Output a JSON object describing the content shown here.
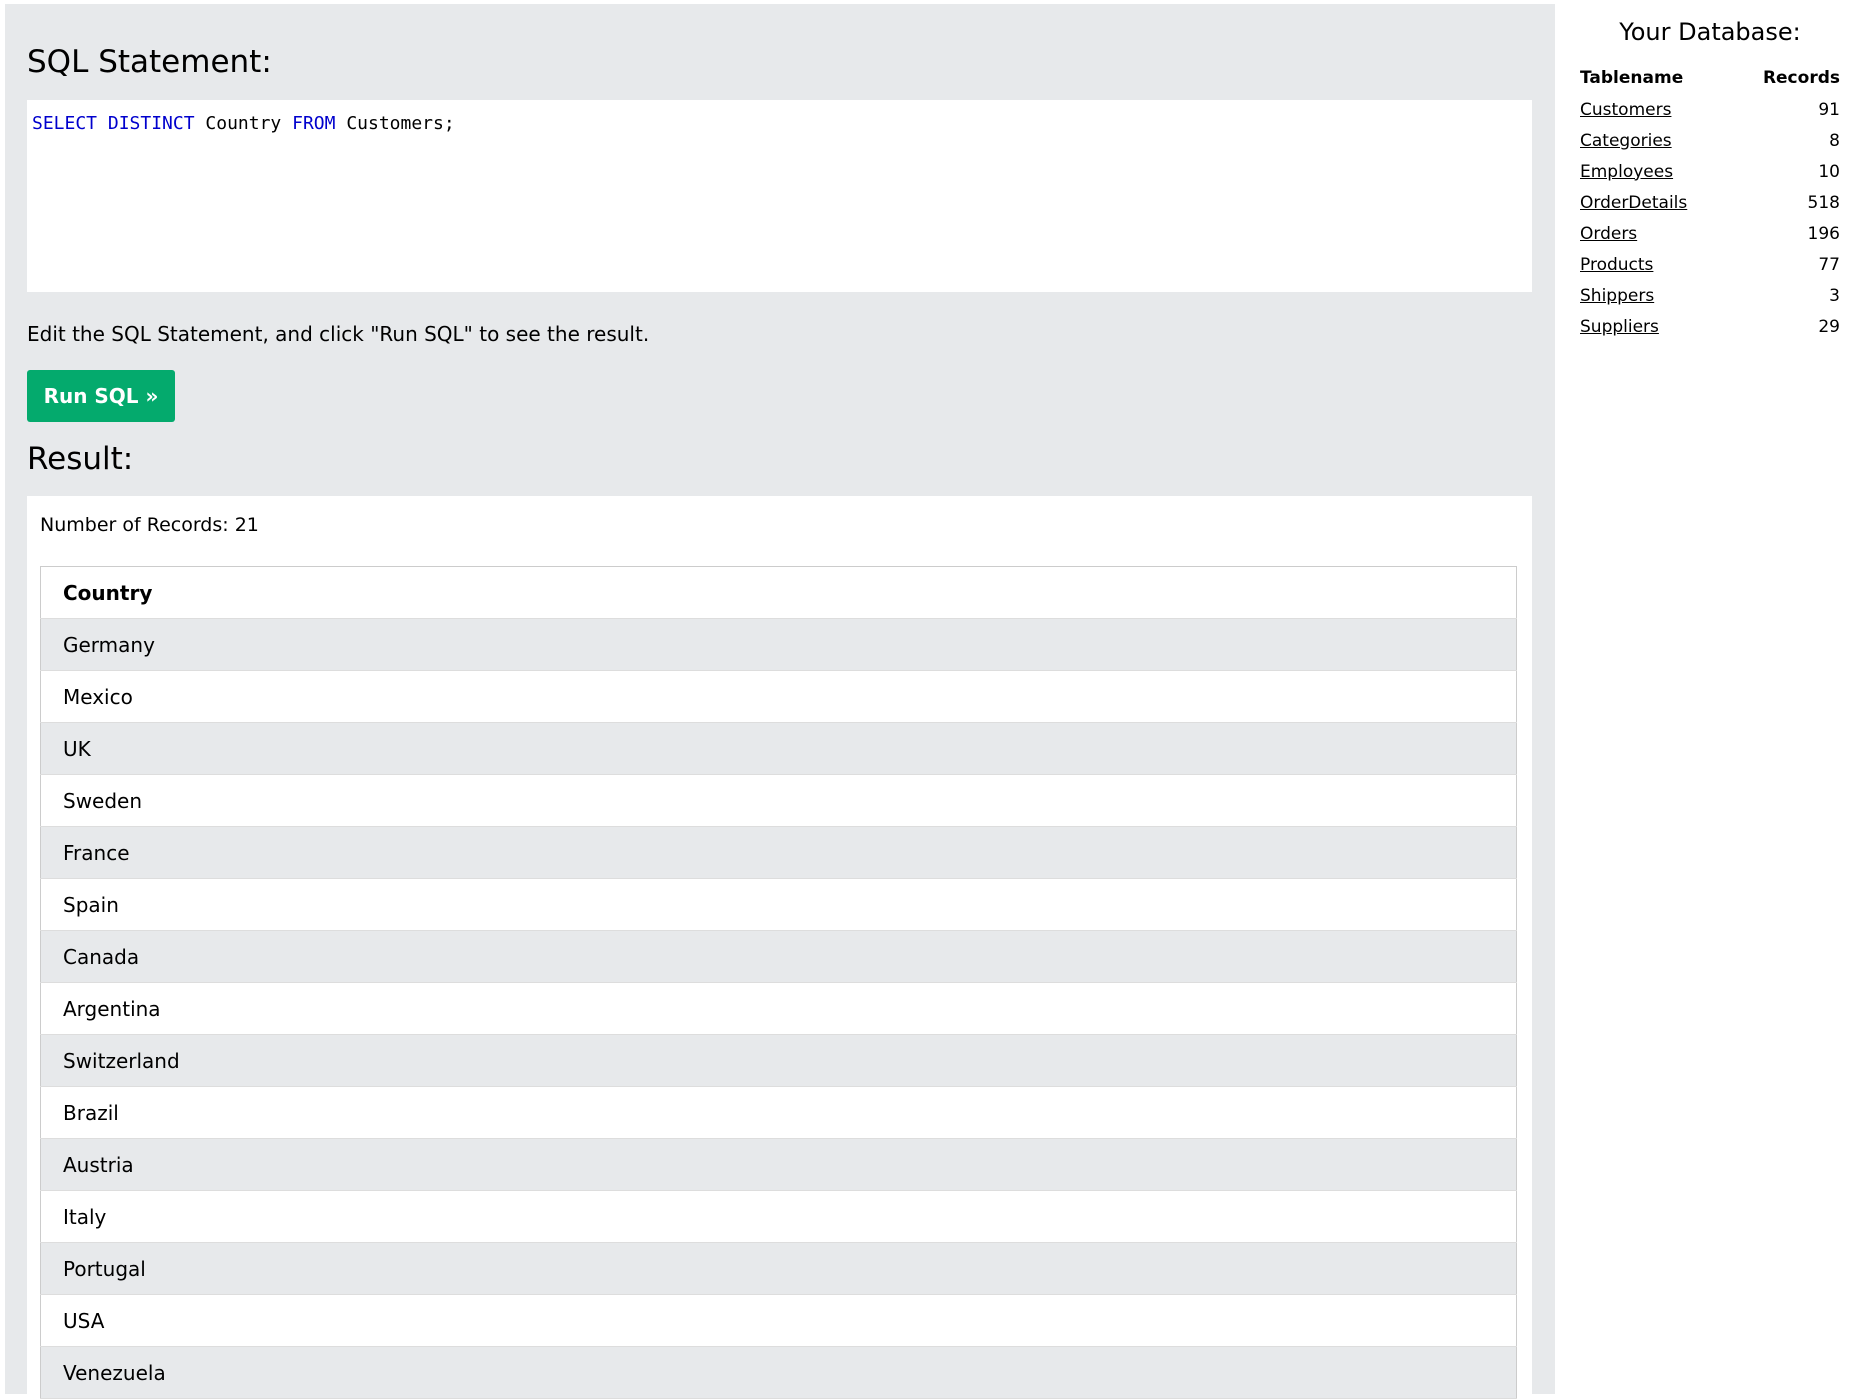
{
  "editor": {
    "heading": "SQL Statement:",
    "code": [
      {
        "text": "SELECT",
        "kind": "keyword"
      },
      {
        "text": " ",
        "kind": "space"
      },
      {
        "text": "DISTINCT",
        "kind": "keyword"
      },
      {
        "text": " Country ",
        "kind": "ident"
      },
      {
        "text": "FROM",
        "kind": "keyword"
      },
      {
        "text": " Customers;",
        "kind": "ident"
      }
    ],
    "instruction": "Edit the SQL Statement, and click \"Run SQL\" to see the result.",
    "run_label": "Run SQL »"
  },
  "result": {
    "heading": "Result:",
    "record_count": "Number of Records: 21",
    "column": "Country",
    "rows": [
      "Germany",
      "Mexico",
      "UK",
      "Sweden",
      "France",
      "Spain",
      "Canada",
      "Argentina",
      "Switzerland",
      "Brazil",
      "Austria",
      "Italy",
      "Portugal",
      "USA",
      "Venezuela"
    ]
  },
  "database": {
    "title": "Your Database:",
    "col_name": "Tablename",
    "col_records": "Records",
    "tables": [
      {
        "name": "Customers",
        "records": "91"
      },
      {
        "name": "Categories",
        "records": "8"
      },
      {
        "name": "Employees",
        "records": "10"
      },
      {
        "name": "OrderDetails",
        "records": "518"
      },
      {
        "name": "Orders",
        "records": "196"
      },
      {
        "name": "Products",
        "records": "77"
      },
      {
        "name": "Shippers",
        "records": "3"
      },
      {
        "name": "Suppliers",
        "records": "29"
      }
    ]
  },
  "colors": {
    "panel_bg": "#e7e9eb",
    "run_button": "#04aa6d",
    "sql_keyword": "#0000cd"
  }
}
